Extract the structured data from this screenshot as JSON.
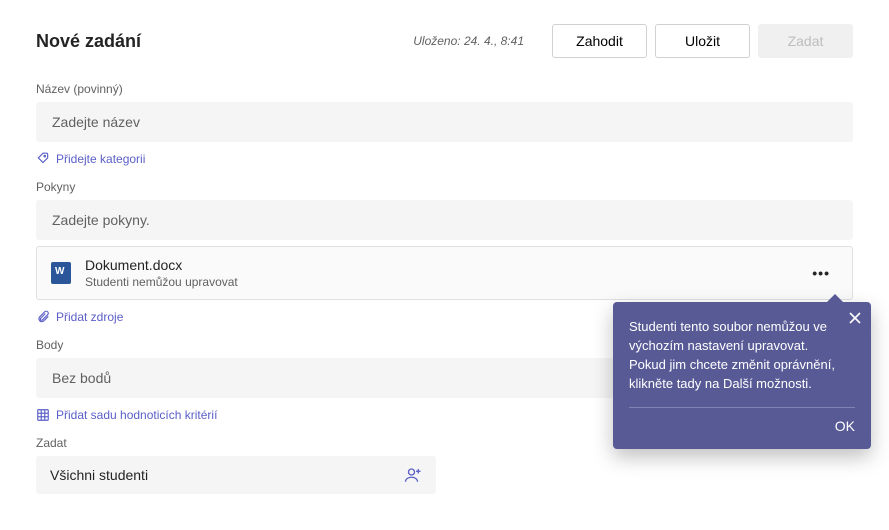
{
  "header": {
    "title": "Nové zadání",
    "saved": "Uloženo: 24. 4., 8:41",
    "discard": "Zahodit",
    "save": "Uložit",
    "assign": "Zadat"
  },
  "fields": {
    "title_label": "Název (povinný)",
    "title_placeholder": "Zadejte název",
    "add_category": "Přidejte kategorii",
    "instructions_label": "Pokyny",
    "instructions_placeholder": "Zadejte pokyny.",
    "add_resources": "Přidat zdroje",
    "points_label": "Body",
    "points_placeholder": "Bez bodů",
    "add_rubric": "Přidat sadu hodnoticích kritérií",
    "assign_label": "Zadat",
    "assign_value": "Všichni studenti"
  },
  "attachment": {
    "name": "Dokument.docx",
    "sub": "Studenti nemůžou upravovat"
  },
  "tooltip": {
    "body": "Studenti tento soubor nemůžou ve výchozím nastavení upravovat. Pokud jim chcete změnit oprávnění, klikněte tady na Další možnosti.",
    "ok": "OK"
  }
}
